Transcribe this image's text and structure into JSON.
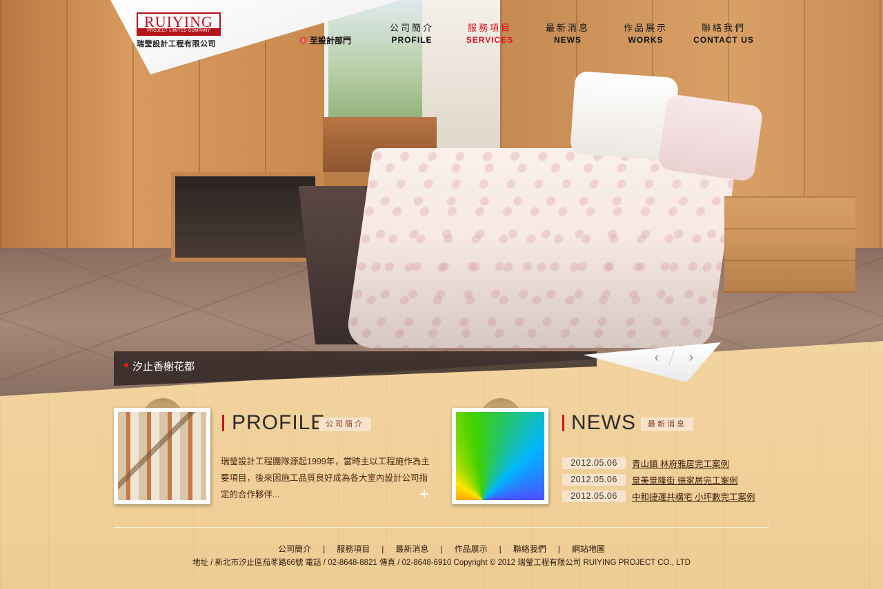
{
  "logo": {
    "brand": "RUIYING",
    "tagline": "PROJECT LIMITED COMPANY",
    "name_cn": "瑞瑩設計工程有限公司"
  },
  "nav": {
    "dept_link": "至設計部門",
    "items": [
      {
        "cn": "公司簡介",
        "en": "PROFILE"
      },
      {
        "cn": "服務項目",
        "en": "SERVICES"
      },
      {
        "cn": "最新消息",
        "en": "NEWS"
      },
      {
        "cn": "作品展示",
        "en": "WORKS"
      },
      {
        "cn": "聯絡我們",
        "en": "CONTACT US"
      }
    ],
    "active_index": 1
  },
  "hero": {
    "caption": "汐止香榭花都",
    "prev_icon": "‹",
    "next_icon": "›"
  },
  "profile": {
    "title": "PROFILE",
    "tag": "公司簡介",
    "text": "瑞瑩設計工程團隊源起1999年，當時主以工程施作為主要項目，後來因施工品質良好成為各大室內設計公司指定的合作夥伴...",
    "more_icon": "+"
  },
  "news": {
    "title": "NEWS",
    "tag": "最新消息",
    "items": [
      {
        "date": "2012.05.06",
        "title": "青山鎮 林府雅居完工案例"
      },
      {
        "date": "2012.05.06",
        "title": "景美景隆街 張家居完工案例"
      },
      {
        "date": "2012.05.06",
        "title": "中和捷運共構宅 小坪數完工案例"
      }
    ]
  },
  "footer": {
    "links": [
      "公司簡介",
      "服務項目",
      "最新消息",
      "作品展示",
      "聯絡我們",
      "網站地圖"
    ],
    "separator": "|",
    "info": "地址 / 新北市汐止區茄苳路66號 電話 / 02-8648-8821 傳真 / 02-8648-6910  Copyright © 2012 瑞瑩工程有限公司 RUIYING PROJECT CO., LTD"
  },
  "colors": {
    "accent": "#d8141c",
    "brand_red": "#b3151b",
    "wood_bg": "#f2d29c",
    "tag_bg": "#f7e3cb"
  }
}
